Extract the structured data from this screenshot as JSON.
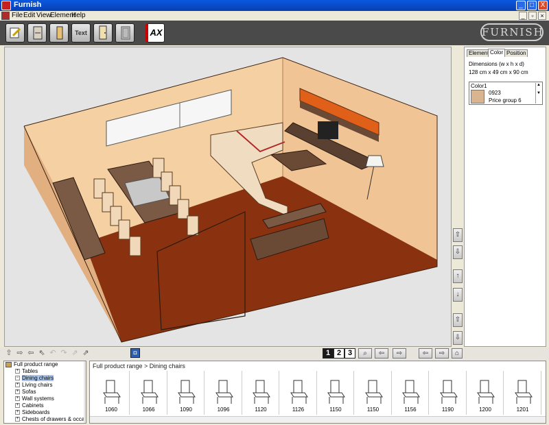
{
  "window": {
    "title": "Furnish",
    "buttons": [
      "_",
      "□",
      "X"
    ]
  },
  "menu": {
    "items": [
      "File",
      "Edit",
      "View",
      "Element",
      "Help"
    ]
  },
  "toolbar": {
    "buttons": [
      {
        "name": "edit-button",
        "icon": "pencil-icon"
      },
      {
        "name": "cabinet-button",
        "icon": "cabinet-icon"
      },
      {
        "name": "panel-button",
        "icon": "panel-icon"
      },
      {
        "name": "text-button",
        "label": "Text",
        "icon": "text-icon"
      },
      {
        "name": "door-button",
        "icon": "door-icon"
      },
      {
        "name": "frame-button",
        "icon": "frame-icon"
      },
      {
        "name": "ax-button",
        "label": "AX"
      }
    ],
    "logo": "FURNISH"
  },
  "panel": {
    "tabs": [
      "Element",
      "Color",
      "Position"
    ],
    "active_tab": "Color",
    "dimensions_label": "Dimensions (w x h x d)",
    "dimensions_value": "128 cm x 49 cm x 90 cm",
    "color_label": "Color1",
    "color_code": "0923",
    "price_group": "Price group 6",
    "swatch_color": "#d9b48e"
  },
  "navbar": {
    "number_buttons": [
      "1",
      "2",
      "3"
    ]
  },
  "tree": {
    "root": "Full product range",
    "items": [
      {
        "label": "Tables",
        "sign": "+"
      },
      {
        "label": "Dining chairs",
        "sign": "−",
        "selected": true
      },
      {
        "label": "Living chairs",
        "sign": "+"
      },
      {
        "label": "Sofas",
        "sign": "+"
      },
      {
        "label": "Wall systems",
        "sign": "+"
      },
      {
        "label": "Cabinets",
        "sign": "+"
      },
      {
        "label": "Sideboards",
        "sign": "+"
      },
      {
        "label": "Chests of drawers & occasio",
        "sign": "+"
      }
    ]
  },
  "gallery": {
    "breadcrumb": "Full product range > Dining chairs",
    "products": [
      "1060",
      "1066",
      "1090",
      "1096",
      "1120",
      "1126",
      "1150",
      "1150",
      "1156",
      "1190",
      "1200",
      "1201"
    ]
  },
  "colors": {
    "floor": "#8a3210",
    "wall_left": "#e8b888",
    "wall_back": "#f2cc9e",
    "accent_orange": "#e0601a",
    "toolbar_bg": "#4a4a4a"
  }
}
